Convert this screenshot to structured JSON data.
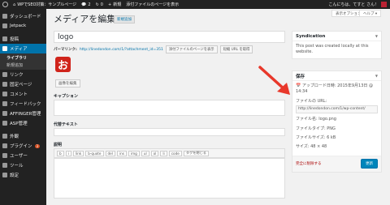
{
  "adminbar": {
    "site_name": "WPでSEO対策：サンプルページ",
    "comments_count": "2",
    "updates_count": "0",
    "new_label": "新規",
    "view_attachment": "添付ファイルのページを表示",
    "greeting": "こんにちは、てすと さん！"
  },
  "sidebar": {
    "items": [
      {
        "label": "ダッシュボード"
      },
      {
        "label": "Jetpack"
      },
      {
        "label": "投稿"
      },
      {
        "label": "メディア"
      },
      {
        "label": "リンク"
      },
      {
        "label": "固定ページ"
      },
      {
        "label": "コメント"
      },
      {
        "label": "フィードバック"
      },
      {
        "label": "AFFINGER管理"
      },
      {
        "label": "ASP管理"
      },
      {
        "label": "外観"
      },
      {
        "label": "プラグイン",
        "badge": "3"
      },
      {
        "label": "ユーザー"
      },
      {
        "label": "ツール"
      },
      {
        "label": "設定"
      }
    ],
    "media_sub": [
      "ライブラリ",
      "新規追加"
    ]
  },
  "header": {
    "screen_options": "表示オプション ▾",
    "help": "ヘルプ ▾",
    "title": "メディアを編集",
    "add_new": "新規追加"
  },
  "editor": {
    "title_value": "logo",
    "permalink_label": "パーマリンク:",
    "permalink_url": "http://linedondon.com/1/?attachment_id=351",
    "view_attachment_btn": "添付ファイルのページを表示",
    "get_shortlink_btn": "短縮 URL を取得",
    "image_glyph": "お",
    "edit_image_btn": "画像を編集",
    "caption_label": "キャプション",
    "alt_label": "代替テキスト",
    "description_label": "説明",
    "quicktags": [
      "b",
      "i",
      "link",
      "b-quote",
      "del",
      "ins",
      "img",
      "ul",
      "ol",
      "li",
      "code",
      "タグを閉じる"
    ]
  },
  "syndication": {
    "title": "Syndication",
    "body": "This post was created locally at this website."
  },
  "save_box": {
    "title": "保存",
    "uploaded_on": "アップロード日時: 2015年9月13日 @ 14:34",
    "file_url_label": "ファイルの URL:",
    "file_url": "http://linedondon.com/1/wp-content/",
    "file_name": "ファイル名: logo.png",
    "file_type": "ファイルタイプ: PNG",
    "file_size": "ファイルサイズ: 6 kB",
    "dimensions": "サイズ: 48 × 48",
    "delete_link": "完全に削除する",
    "update_btn": "更新"
  },
  "colors": {
    "admin_bg": "#222222",
    "accent": "#0073aa",
    "arrow": "#e8382b",
    "logo_red": "#d0241b"
  }
}
